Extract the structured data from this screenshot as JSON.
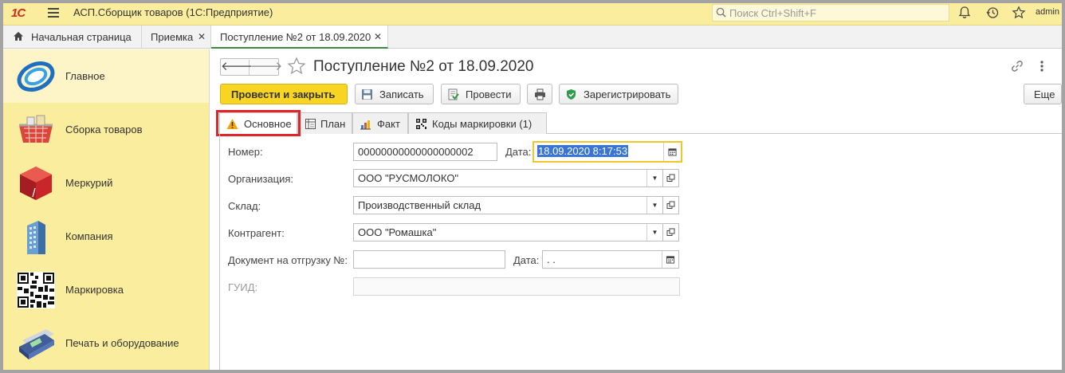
{
  "titlebar": {
    "logo": "1С",
    "title": "АСП.Сборщик товаров  (1С:Предприятие)",
    "search_placeholder": "Поиск Ctrl+Shift+F",
    "user": "admin"
  },
  "tabs": [
    {
      "label": "Начальная страница"
    },
    {
      "label": "Приемка"
    },
    {
      "label": "Поступление №2 от 18.09.2020"
    }
  ],
  "close_glyph": "✕",
  "sidebar": {
    "items": [
      {
        "label": "Главное",
        "icon": "main-section-icon"
      },
      {
        "label": "Сборка товаров",
        "icon": "basket-icon"
      },
      {
        "label": "Меркурий",
        "icon": "cube-icon"
      },
      {
        "label": "Компания",
        "icon": "building-icon"
      },
      {
        "label": "Маркировка",
        "icon": "qr-code-icon"
      },
      {
        "label": "Печать и оборудование",
        "icon": "terminal-icon"
      }
    ]
  },
  "document": {
    "title": "Поступление №2 от 18.09.2020",
    "nav_back": "🡐",
    "nav_forward": "🡒"
  },
  "toolbar": {
    "post_and_close": "Провести и закрыть",
    "save": "Записать",
    "post": "Провести",
    "register": "Зарегистрировать",
    "more": "Еще"
  },
  "form_tabs": [
    {
      "label": "Основное",
      "icon": "warning-icon"
    },
    {
      "label": "План",
      "icon": "plan-icon"
    },
    {
      "label": "Факт",
      "icon": "chart-icon"
    },
    {
      "label": "Коды маркировки  (1)",
      "icon": "qr-code-icon"
    }
  ],
  "form": {
    "number_label": "Номер:",
    "number_value": "00000000000000000002",
    "date_label": "Дата:",
    "date_value": "18.09.2020  8:17:53",
    "org_label": "Организация:",
    "org_value": "ООО \"РУСМОЛОКО\"",
    "warehouse_label": "Склад:",
    "warehouse_value": "Производственный склад",
    "counterparty_label": "Контрагент:",
    "counterparty_value": "ООО \"Ромашка\"",
    "shipment_doc_label": "Документ на отгрузку №:",
    "shipment_doc_value": "",
    "shipment_date_label": "Дата:",
    "shipment_date_value": "  .  .",
    "guid_label": "ГУИД:",
    "guid_value": ""
  },
  "colors": {
    "accent_yellow": "#f9d523",
    "sidebar_bg": "#fbed9e",
    "highlight_red": "#e0242b"
  }
}
